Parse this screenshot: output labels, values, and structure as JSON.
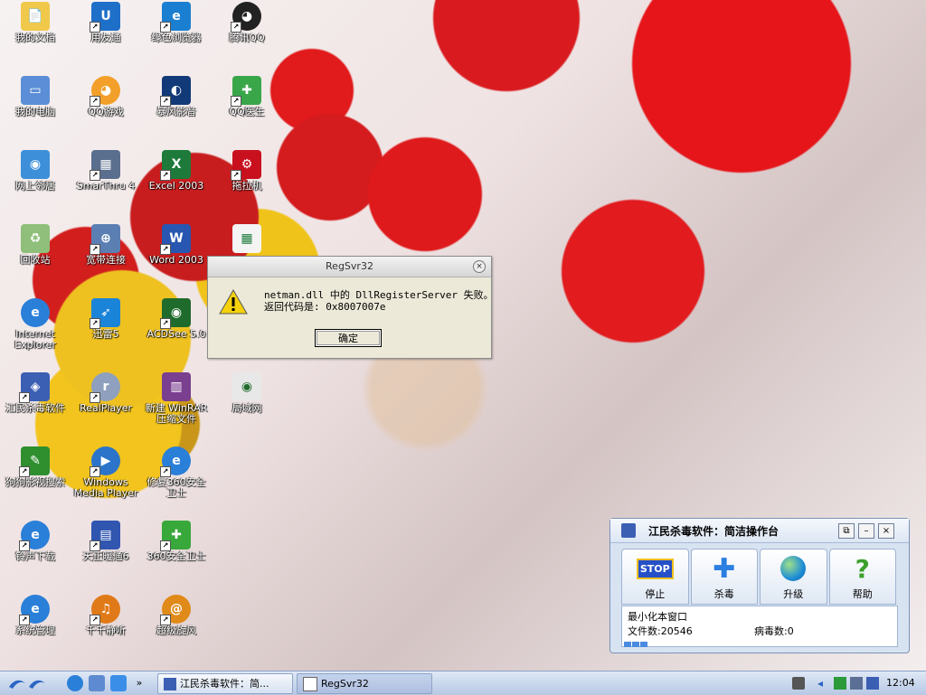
{
  "desktop": {
    "icons": [
      {
        "label": "我的文档"
      },
      {
        "label": "我的电脑"
      },
      {
        "label": "网上邻居"
      },
      {
        "label": "回收站"
      },
      {
        "label": "Internet\nExplorer"
      },
      {
        "label": "江民杀毒软件"
      },
      {
        "label": "狗狗影视搜索"
      },
      {
        "label": "铃声下载"
      },
      {
        "label": "系统管理"
      },
      {
        "label": "用友通"
      },
      {
        "label": "QQ游戏"
      },
      {
        "label": "SmarThru 4"
      },
      {
        "label": "宽带连接"
      },
      {
        "label": "迅雷5"
      },
      {
        "label": "RealPlayer"
      },
      {
        "label": "Windows\nMedia Player"
      },
      {
        "label": "天正暖通6"
      },
      {
        "label": "千千静听"
      },
      {
        "label": "绿色浏览器"
      },
      {
        "label": "暴风影音"
      },
      {
        "label": "Excel 2003"
      },
      {
        "label": "Word 2003"
      },
      {
        "label": "ACDSee 5.0"
      },
      {
        "label": "新建 WinRAR\n压缩文件"
      },
      {
        "label": "修复360安全\n卫士"
      },
      {
        "label": "360安全卫士"
      },
      {
        "label": "超级旋风"
      },
      {
        "label": "腾讯QQ"
      },
      {
        "label": "QQ医生"
      },
      {
        "label": "拖拉机"
      },
      {
        "label": "局域网"
      }
    ]
  },
  "dialog": {
    "title": "RegSvr32",
    "message": "netman.dll 中的 DllRegisterServer 失败。\n返回代码是: 0x8007007e",
    "ok_label": "确定"
  },
  "antivirus": {
    "title": "江民杀毒软件：简洁操作台",
    "tools": [
      {
        "label": "停止",
        "icon_text": "STOP"
      },
      {
        "label": "杀毒"
      },
      {
        "label": "升级"
      },
      {
        "label": "帮助"
      }
    ],
    "minimize_text": "最小化本窗口",
    "files_text": "文件数:20546",
    "virus_text": "病毒数:0",
    "progress_blocks": 3
  },
  "taskbar": {
    "buttons": [
      {
        "label": "江民杀毒软件：简..."
      },
      {
        "label": "RegSvr32"
      }
    ],
    "clock": "12:04"
  },
  "colors": {
    "accent": "#3b5fb3",
    "taskbar": "#c9d7ee"
  }
}
